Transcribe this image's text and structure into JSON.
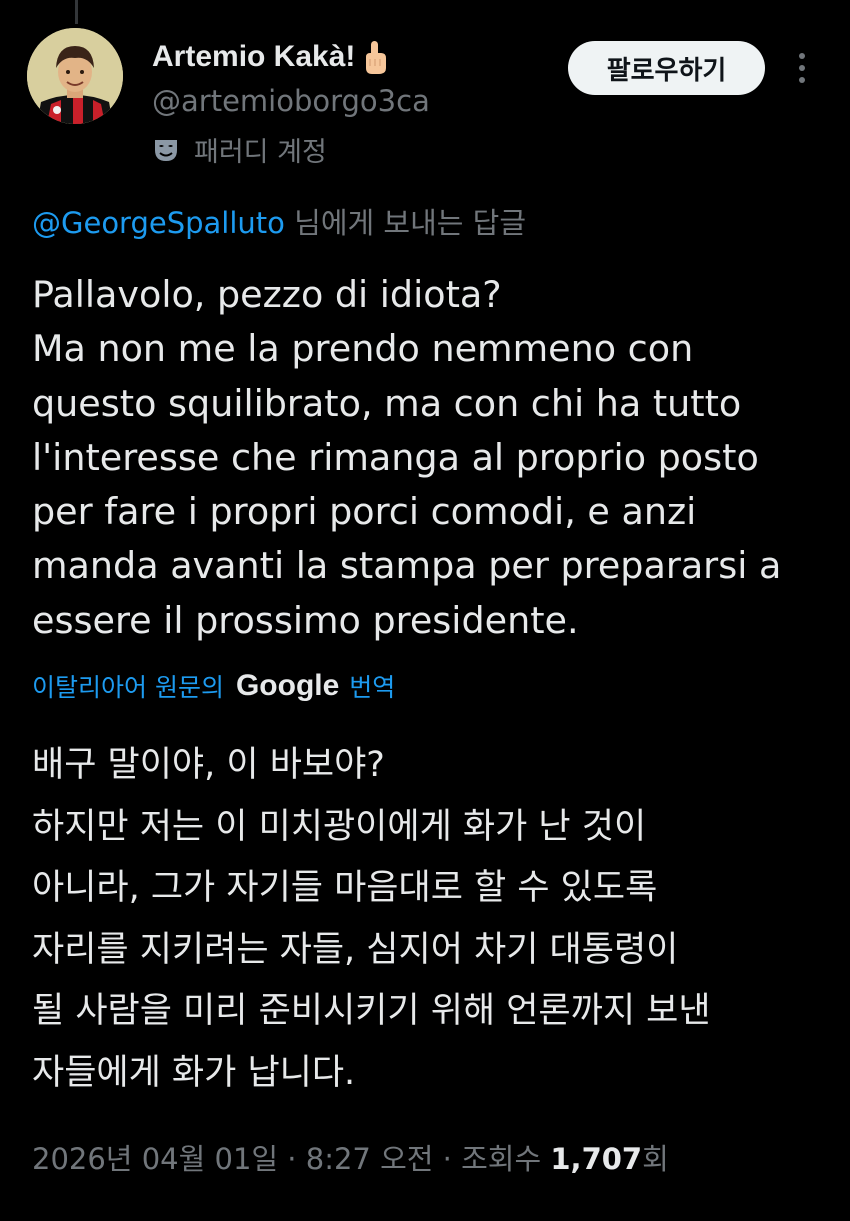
{
  "author": {
    "display_name": "Artemio Kakà!",
    "name_emoji": "pointing-up-hand-emoji",
    "handle": "@artemioborgo3ca",
    "badge_icon": "parody-mask-icon",
    "badge_label": "패러디 계정",
    "avatar": "avatar-illustration"
  },
  "header": {
    "follow_label": "팔로우하기",
    "more_icon": "more-vertical-icon"
  },
  "reply_context": {
    "mention": "@GeorgeSpalluto",
    "suffix": " 님에게 보내는 답글"
  },
  "tweet": {
    "lines": [
      "Pallavolo, pezzo di idiota?",
      "Ma non me la prendo nemmeno con",
      "questo squilibrato, ma con chi ha tutto",
      "l'interesse che rimanga al proprio posto",
      "per fare i propri porci comodi, e anzi",
      "manda avanti la stampa per prepararsi a",
      "essere il prossimo presidente."
    ]
  },
  "translation": {
    "source_label": "이탈리아어 원문의",
    "provider": "Google",
    "action_label": "번역",
    "lines": [
      "배구 말이야, 이 바보야?",
      "하지만 저는 이 미치광이에게 화가 난 것이",
      "아니라, 그가 자기들 마음대로 할 수 있도록",
      "자리를 지키려는 자들, 심지어 차기 대통령이",
      "될 사람을 미리 준비시키기 위해 언론까지 보낸",
      "자들에게 화가 납니다."
    ]
  },
  "meta": {
    "date": "2026년 04월 01일",
    "separator": " · ",
    "time": "8:27 오전",
    "views_label": "조회수 ",
    "views_count": "1,707",
    "views_suffix": "회"
  },
  "colors": {
    "background": "#000000",
    "text_primary": "#e7e9ea",
    "text_secondary": "#71767b",
    "accent": "#1d9bf0",
    "button_bg": "#eff3f4"
  }
}
